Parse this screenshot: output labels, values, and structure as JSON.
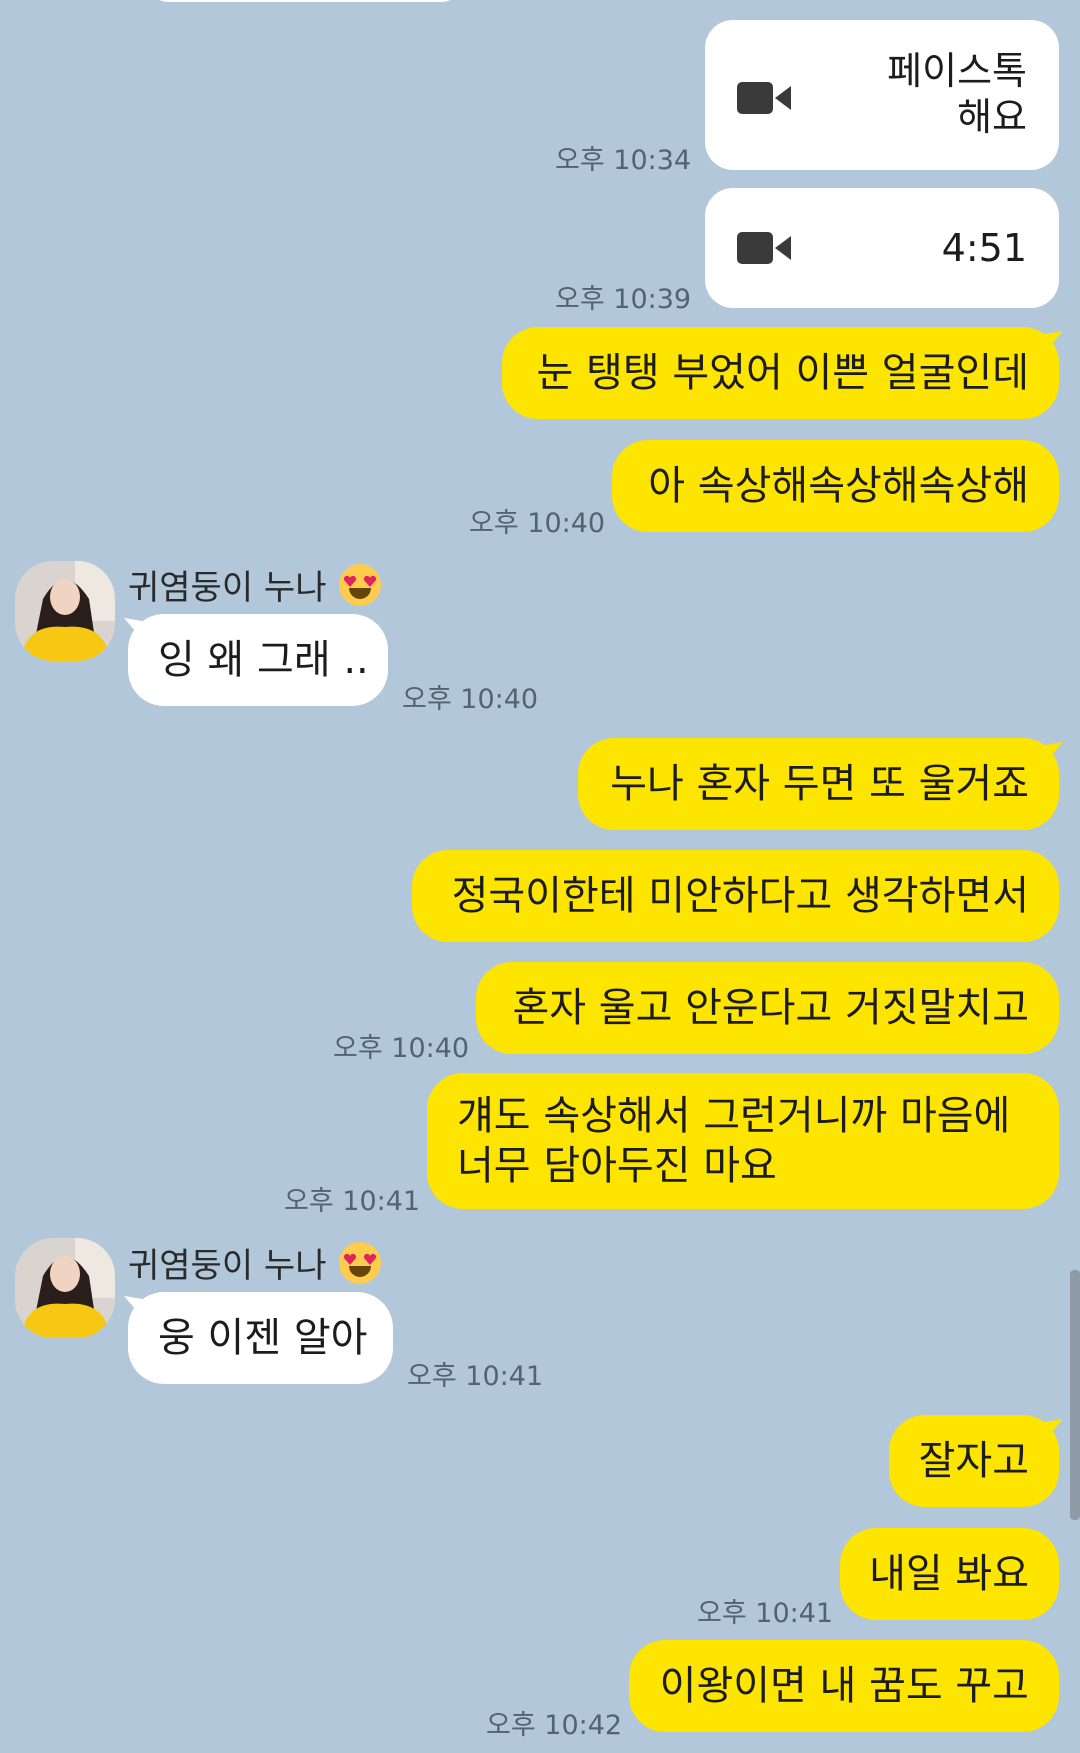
{
  "chat": {
    "contact_name": "귀염둥이 누나",
    "calls": [
      {
        "text": "페이스톡\n해요",
        "time": "오후 10:34"
      },
      {
        "text": "4:51",
        "time": "오후 10:39"
      }
    ],
    "messages": [
      {
        "text": "눈 탱탱 부었어 이쁜 얼굴인데"
      },
      {
        "text": "아 속상해속상해속상해",
        "time": "오후 10:40"
      },
      {
        "text": "잉 왜 그래 ..",
        "time": "오후 10:40"
      },
      {
        "text": "누나 혼자 두면 또 울거죠"
      },
      {
        "text": "정국이한테 미안하다고 생각하면서"
      },
      {
        "text": "혼자 울고 안운다고 거짓말치고",
        "time": "오후 10:40"
      },
      {
        "text": "걔도 속상해서 그런거니까 마음에\n너무 담아두진 마요",
        "time": "오후 10:41"
      },
      {
        "text": "웅 이젠 알아",
        "time": "오후 10:41"
      },
      {
        "text": "잘자고"
      },
      {
        "text": "내일 봐요",
        "time": "오후 10:41"
      },
      {
        "text": "이왕이면 내 꿈도 꾸고",
        "time": "오후 10:42"
      }
    ]
  },
  "colors": {
    "background": "#b2c7da",
    "my_bubble": "#fee500",
    "other_bubble": "#ffffff"
  },
  "icons": {
    "call": "video-camera-icon",
    "emoji": "heart-eyes-emoji-icon"
  }
}
